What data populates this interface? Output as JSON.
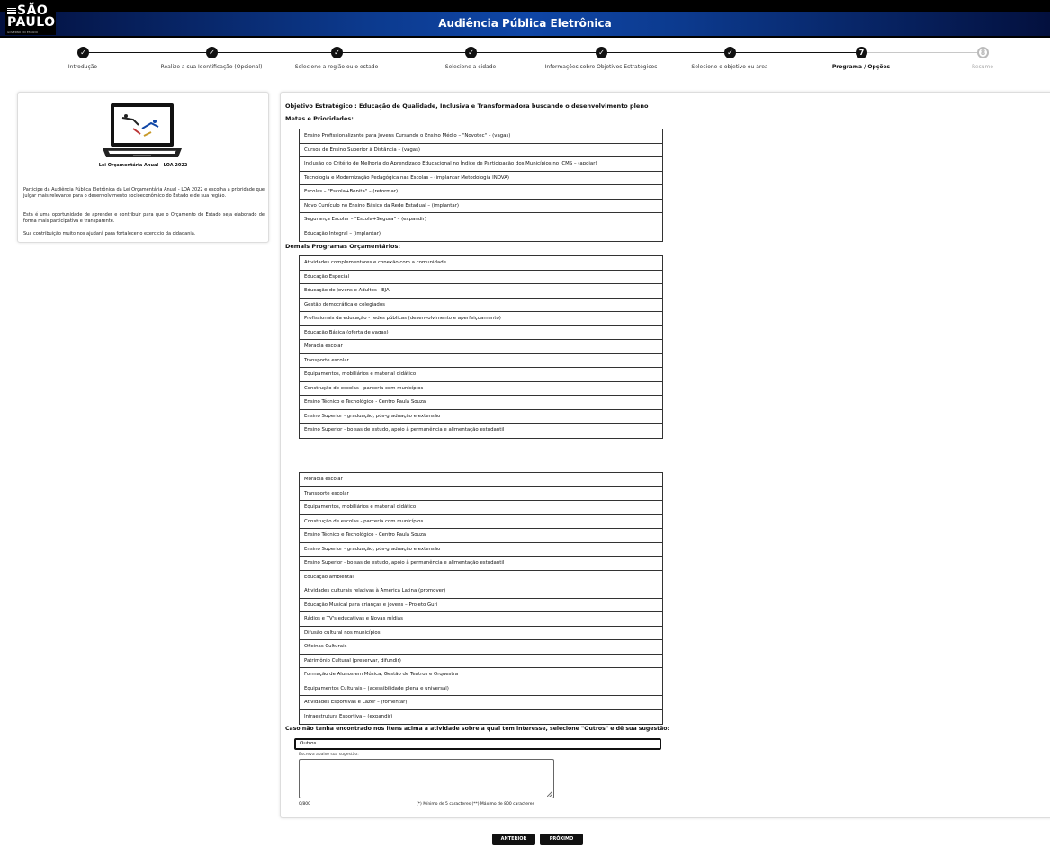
{
  "header": {
    "logo_line1": "SÃO",
    "logo_line2": "PAULO",
    "logo_sub": "GOVERNO DO ESTADO",
    "title": "Audiência Pública Eletrônica",
    "colors": {
      "band": "#0f46a6",
      "bar": "#000000"
    }
  },
  "stepper": {
    "steps": [
      {
        "label": "Introdução",
        "state": "done"
      },
      {
        "label": "Realize a sua Identificação (Opcional)",
        "state": "done"
      },
      {
        "label": "Selecione a região ou o estado",
        "state": "done"
      },
      {
        "label": "Selecione a cidade",
        "state": "done"
      },
      {
        "label": "Informações sobre Objetivos Estratégicos",
        "state": "done"
      },
      {
        "label": "Selecione o objetivo ou área",
        "state": "done"
      },
      {
        "label": "Programa / Opções",
        "state": "active",
        "number": "7"
      },
      {
        "label": "Resumo",
        "state": "future",
        "number": "8"
      }
    ]
  },
  "sidebar": {
    "image_caption": "Lei Orçamentária Anual - LOA 2022",
    "paragraphs": [
      "Participe da Audiência Pública Eletrônica da Lei Orçamentária Anual - LOA 2022 e escolha a prioridade que julgar mais relevante para o desenvolvimento socioeconômico do Estado e de sua região.",
      "Esta é uma oportunidade de aprender e contribuir para que o Orçamento do Estado seja elaborado de forma mais participativa e transparente.",
      "Sua contribuição muito nos ajudará para fortalecer o exercício da cidadania."
    ]
  },
  "main": {
    "objective_title": "Objetivo Estratégico : Educação de Qualidade, Inclusiva e Transformadora buscando o desenvolvimento pleno",
    "metas_heading": "Metas e Prioridades:",
    "metas": [
      "Ensino Profissionalizante para Jovens Cursando o Ensino Médio – \"Novotec\" – (vagas)",
      "Cursos de Ensino Superior à Distância – (vagas)",
      "Inclusão do Critério de Melhoria do Aprendizado Educacional no Índice de Participação dos Municípios no ICMS – (apoiar)",
      "Tecnologia e Modernização Pedagógica nas Escolas – (implantar Metodologia INOVA)",
      "Escolas – \"Escola+Bonita\" – (reformar)",
      "Novo Currículo no Ensino Básico da Rede Estadual – (implantar)",
      "Segurança Escolar – \"Escola+Segura\" – (expandir)",
      "Educação Integral – (implantar)"
    ],
    "demais_heading": "Demais Programas Orçamentários:",
    "demais_list_a": [
      "Atividades complementares e conexão com a comunidade",
      "Educação Especial",
      "Educação de Jovens e Adultos - EJA",
      "Gestão democrática e colegiados",
      "Profissionais da educação - redes públicas (desenvolvimento e aperfeiçoamento)",
      "Educação Básica (oferta de vagas)",
      "Moradia escolar",
      "Transporte escolar",
      "Equipamentos, mobiliários e material didático",
      "Construção de escolas - parceria com municípios",
      "Ensino Técnico e Tecnológico - Centro Paula Souza",
      "Ensino Superior - graduação, pós-graduação e extensão",
      "Ensino Superior - bolsas de estudo, apoio à permanência e alimentação estudantil"
    ],
    "demais_list_b": [
      "Moradia escolar",
      "Transporte escolar",
      "Equipamentos, mobiliários e material didático",
      "Construção de escolas - parceria com municípios",
      "Ensino Técnico e Tecnológico - Centro Paula Souza",
      "Ensino Superior - graduação, pós-graduação e extensão",
      "Ensino Superior - bolsas de estudo, apoio à permanência e alimentação estudantil",
      "Educação ambiental",
      "Atividades culturais relativas à América Latina (promover)",
      "Educação Musical para crianças e jovens – Projeto Guri",
      "Rádios e TV's educativas e Novas mídias",
      "Difusão cultural nos municípios",
      "Oficinas Culturais",
      "Patrimônio Cultural (preservar, difundir)",
      "Formação de Alunos em Música, Gestão de Teatros e Orquestra",
      "Equipamentos Culturais – (acessibilidade plena e universal)",
      "Atividades Esportivas e Lazer – (fomentar)",
      "Infraestrutura Esportiva – (expandir)"
    ],
    "other_prompt": "Caso não tenha encontrado nos itens acima a atividade sobre a qual tem interesse, selecione \"Outros\" e dê sua sugestão:",
    "other_option": "Outros",
    "suggestion_hint": "Escreva abaixo sua sugestão:",
    "suggestion_value": "",
    "char_counter": "0/800",
    "char_limits": "(*) Mínimo de 5 caracteres (**) Máximo de 800 caracteres"
  },
  "footer": {
    "prev_label": "ANTERIOR",
    "next_label": "PRÓXIMO"
  }
}
